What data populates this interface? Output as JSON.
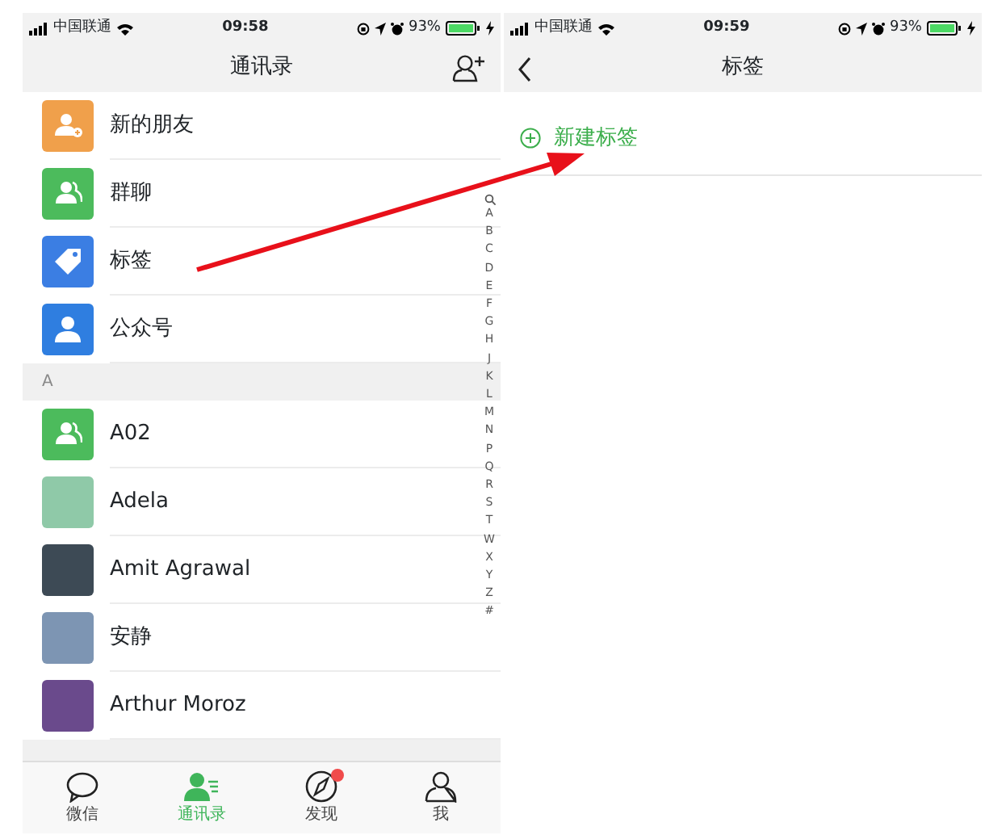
{
  "left_screen": {
    "status_bar": {
      "carrier": "中国联通",
      "time": "09:58",
      "battery": "93%"
    },
    "title": "通讯录",
    "shortcuts": [
      {
        "label": "新的朋友",
        "kind": "person-plus",
        "color": "#f0a04b"
      },
      {
        "label": "群聊",
        "kind": "group",
        "color": "#4cbb5c"
      },
      {
        "label": "标签",
        "kind": "tag",
        "color": "#3b7ee3"
      },
      {
        "label": "公众号",
        "kind": "person",
        "color": "#2f7ee0"
      }
    ],
    "section": "A",
    "contacts": [
      {
        "name": "A02",
        "kind": "group",
        "color": "#4cbb5c"
      },
      {
        "name": "Adela",
        "kind": "photo",
        "color": "#8fc9a8"
      },
      {
        "name": "Amit Agrawal",
        "kind": "photo",
        "color": "#3d4a55"
      },
      {
        "name": "安静",
        "kind": "photo",
        "color": "#7d95b3"
      },
      {
        "name": "Arthur Moroz",
        "kind": "photo",
        "color": "#6a4a8c"
      }
    ],
    "index": [
      "A",
      "B",
      "C",
      "D",
      "E",
      "F",
      "G",
      "H",
      "J",
      "K",
      "L",
      "M",
      "N",
      "P",
      "Q",
      "R",
      "S",
      "T",
      "W",
      "X",
      "Y",
      "Z",
      "#"
    ],
    "tab_bar": [
      {
        "label": "微信",
        "kind": "chat",
        "selected": false,
        "badge": false
      },
      {
        "label": "通讯录",
        "kind": "contacts",
        "selected": true,
        "badge": false
      },
      {
        "label": "发现",
        "kind": "compass",
        "selected": false,
        "badge": true
      },
      {
        "label": "我",
        "kind": "me",
        "selected": false,
        "badge": false
      }
    ]
  },
  "right_screen": {
    "status_bar": {
      "carrier": "中国联通",
      "time": "09:59",
      "battery": "93%"
    },
    "title": "标签",
    "new_tag": "新建标签"
  }
}
